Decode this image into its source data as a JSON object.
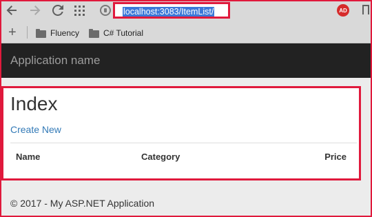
{
  "browser": {
    "url": "localhost:3083/ItemList/",
    "profile_initials": "AD",
    "nav_icons": [
      "back-arrow-icon",
      "forward-arrow-icon",
      "reload-icon",
      "apps-grid-icon",
      "site-info-icon"
    ],
    "bookmarks": [
      {
        "label": "Fluency",
        "icon": "folder-icon"
      },
      {
        "label": "C# Tutorial",
        "icon": "folder-icon"
      }
    ],
    "highlight_color": "#e0193c",
    "selection_color": "#3c78d8"
  },
  "app": {
    "brand": "Application name",
    "navbar_color": "#222222"
  },
  "page": {
    "title": "Index",
    "create_link": "Create New",
    "link_color": "#337ab7",
    "table": {
      "columns": [
        "Name",
        "Category",
        "Price"
      ],
      "rows": []
    }
  },
  "footer": {
    "text": "© 2017 - My ASP.NET Application"
  }
}
